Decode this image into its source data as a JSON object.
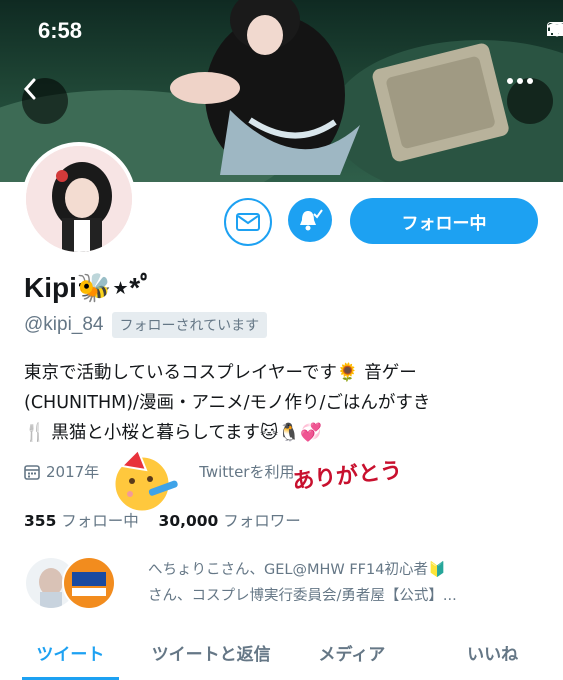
{
  "status_bar": {
    "time": "6:58"
  },
  "profile": {
    "display_name": "Kipi🐝⋆*ﾟ",
    "handle": "@kipi_84",
    "follows_you": "フォローされています",
    "follow_button": "フォロー中",
    "bio_lines": [
      "東京で活動しているコスプレイヤーです🌻 音ゲー",
      "(CHUNITHM)/漫画・アニメ/モノ作り/ごはんがすき",
      "🍴 黒猫と小桜と暮らしてます🐱🐧💞"
    ],
    "joined": "2017年",
    "joined_rest": "Twitterを利用",
    "following_count": "355",
    "following_label": "フォロー中",
    "followers_count": "30,000",
    "followers_label": "フォロワー"
  },
  "followed_by": {
    "line1": "へちょりこさん、GEL@MHW FF14初心者🔰",
    "line2": "さん、コスプレ博実行委員会/勇者屋【公式】..."
  },
  "sticker": {
    "text": "ありがとう"
  },
  "tabs": [
    {
      "label": "ツイート",
      "active": true
    },
    {
      "label": "ツイートと返信",
      "active": false
    },
    {
      "label": "メディア",
      "active": false
    },
    {
      "label": "いいね",
      "active": false
    }
  ],
  "icons": [
    "back-icon",
    "more-icon",
    "mail-icon",
    "bell-icon",
    "calendar-icon",
    "signal-icon",
    "wifi-icon",
    "battery-icon"
  ],
  "colors": {
    "accent": "#1da1f2",
    "muted": "#657786",
    "text": "#14171a"
  }
}
